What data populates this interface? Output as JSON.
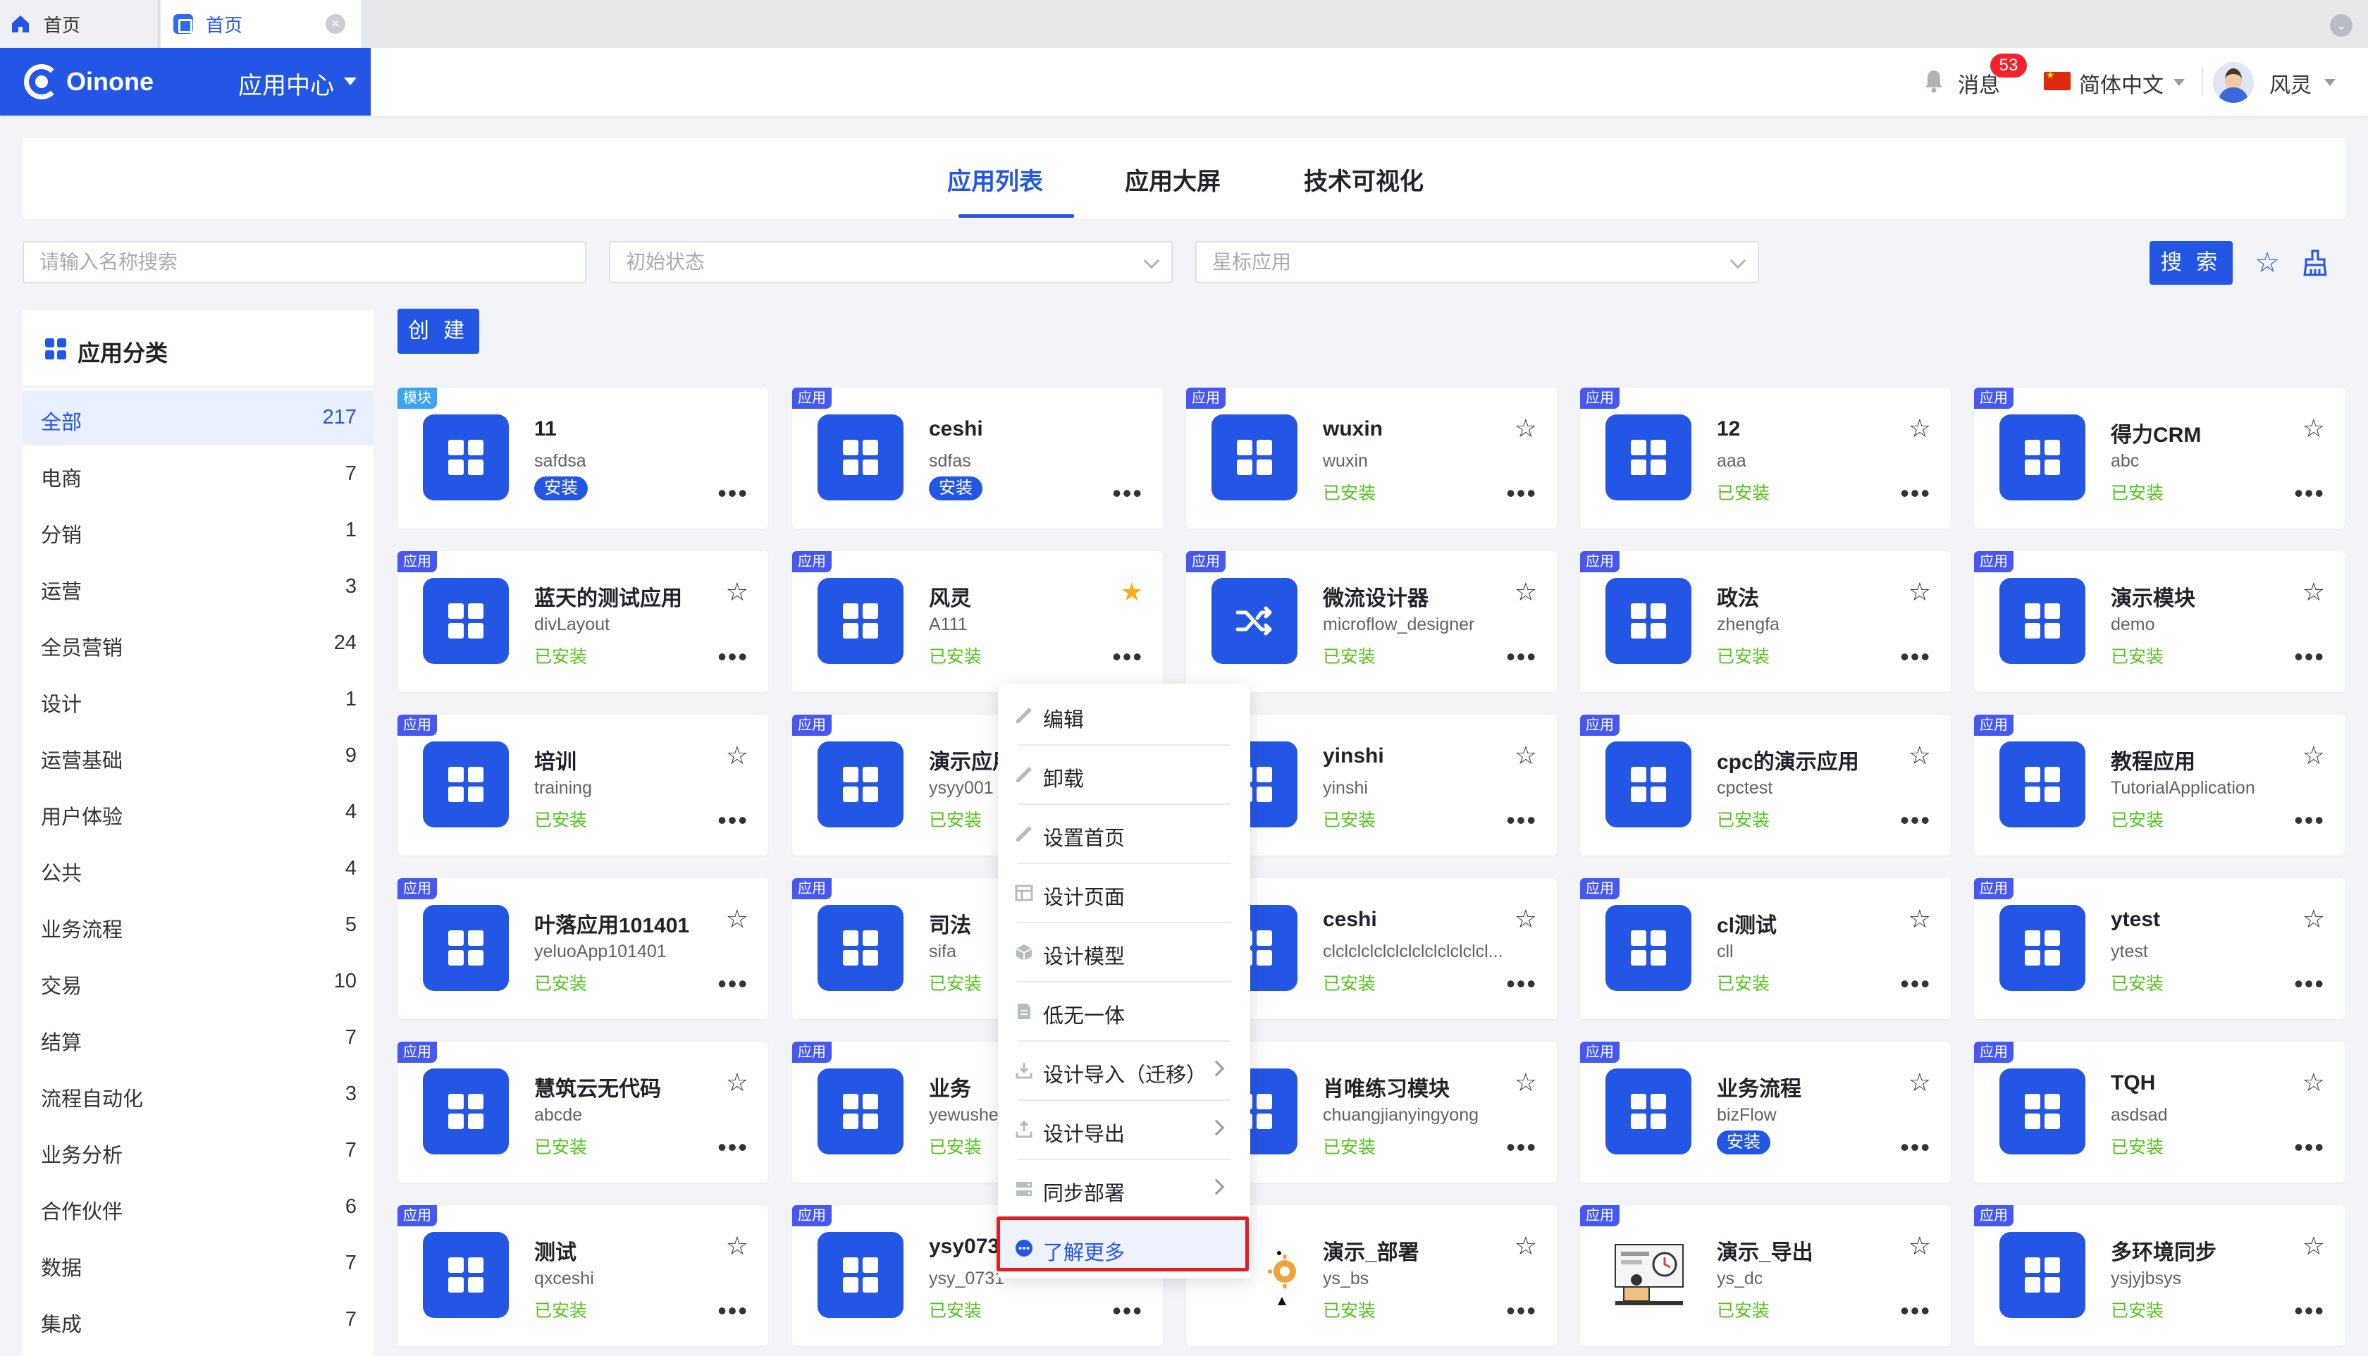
{
  "browser_tabs": [
    {
      "label": "首页",
      "icon": "home-icon"
    },
    {
      "label": "首页",
      "icon": "app-tab-icon"
    }
  ],
  "header": {
    "logo_text": "Oinone",
    "app_center": "应用中心",
    "messages_label": "消息",
    "messages_count": "53",
    "language": "简体中文",
    "user_name": "风灵"
  },
  "main_tabs": [
    "应用列表",
    "应用大屏",
    "技术可视化"
  ],
  "filters": {
    "search_placeholder": "请输入名称搜索",
    "status_placeholder": "初始状态",
    "star_placeholder": "星标应用",
    "search_button": "搜 索"
  },
  "sidebar": {
    "title": "应用分类",
    "items": [
      {
        "label": "全部",
        "count": "217"
      },
      {
        "label": "电商",
        "count": "7"
      },
      {
        "label": "分销",
        "count": "1"
      },
      {
        "label": "运营",
        "count": "3"
      },
      {
        "label": "全员营销",
        "count": "24"
      },
      {
        "label": "设计",
        "count": "1"
      },
      {
        "label": "运营基础",
        "count": "9"
      },
      {
        "label": "用户体验",
        "count": "4"
      },
      {
        "label": "公共",
        "count": "4"
      },
      {
        "label": "业务流程",
        "count": "5"
      },
      {
        "label": "交易",
        "count": "10"
      },
      {
        "label": "结算",
        "count": "7"
      },
      {
        "label": "流程自动化",
        "count": "3"
      },
      {
        "label": "业务分析",
        "count": "7"
      },
      {
        "label": "合作伙伴",
        "count": "6"
      },
      {
        "label": "数据",
        "count": "7"
      },
      {
        "label": "集成",
        "count": "7"
      }
    ]
  },
  "create_button": "创 建",
  "cards": [
    {
      "tag": "模块",
      "name": "11",
      "code": "safdsa",
      "status": "安装",
      "status_type": "install",
      "starred": false,
      "icon": "grid"
    },
    {
      "tag": "应用",
      "name": "ceshi",
      "code": "sdfas",
      "status": "安装",
      "status_type": "install",
      "starred": false,
      "icon": "grid"
    },
    {
      "tag": "应用",
      "name": "wuxin",
      "code": "wuxin",
      "status": "已安装",
      "status_type": "installed",
      "starred": false,
      "icon": "grid"
    },
    {
      "tag": "应用",
      "name": "12",
      "code": "aaa",
      "status": "已安装",
      "status_type": "installed",
      "starred": false,
      "icon": "grid"
    },
    {
      "tag": "应用",
      "name": "得力CRM",
      "code": "abc",
      "status": "已安装",
      "status_type": "installed",
      "starred": false,
      "icon": "grid"
    },
    {
      "tag": "应用",
      "name": "蓝天的测试应用",
      "code": "divLayout",
      "status": "已安装",
      "status_type": "installed",
      "starred": false,
      "icon": "grid"
    },
    {
      "tag": "应用",
      "name": "风灵",
      "code": "A111",
      "status": "已安装",
      "status_type": "installed",
      "starred": true,
      "icon": "grid"
    },
    {
      "tag": "应用",
      "name": "微流设计器",
      "code": "microflow_designer",
      "status": "已安装",
      "status_type": "installed",
      "starred": false,
      "icon": "shuffle"
    },
    {
      "tag": "应用",
      "name": "政法",
      "code": "zhengfa",
      "status": "已安装",
      "status_type": "installed",
      "starred": false,
      "icon": "grid"
    },
    {
      "tag": "应用",
      "name": "演示模块",
      "code": "demo",
      "status": "已安装",
      "status_type": "installed",
      "starred": false,
      "icon": "grid"
    },
    {
      "tag": "应用",
      "name": "培训",
      "code": "training",
      "status": "已安装",
      "status_type": "installed",
      "starred": false,
      "icon": "grid"
    },
    {
      "tag": "应用",
      "name": "演示应用",
      "code": "ysyy001",
      "status": "已安装",
      "status_type": "installed",
      "starred": false,
      "icon": "grid"
    },
    {
      "tag": "应用",
      "name": "yinshi",
      "code": "yinshi",
      "status": "已安装",
      "status_type": "installed",
      "starred": false,
      "icon": "grid"
    },
    {
      "tag": "应用",
      "name": "cpc的演示应用",
      "code": "cpctest",
      "status": "已安装",
      "status_type": "installed",
      "starred": false,
      "icon": "grid"
    },
    {
      "tag": "应用",
      "name": "教程应用",
      "code": "TutorialApplication",
      "status": "已安装",
      "status_type": "installed",
      "starred": false,
      "icon": "grid"
    },
    {
      "tag": "应用",
      "name": "叶落应用101401",
      "code": "yeluoApp101401",
      "status": "已安装",
      "status_type": "installed",
      "starred": false,
      "icon": "grid"
    },
    {
      "tag": "应用",
      "name": "司法",
      "code": "sifa",
      "status": "已安装",
      "status_type": "installed",
      "starred": false,
      "icon": "grid"
    },
    {
      "tag": "应用",
      "name": "ceshi",
      "code": "clclclclclclclclclclclclcl...",
      "status": "已安装",
      "status_type": "installed",
      "starred": false,
      "icon": "grid"
    },
    {
      "tag": "应用",
      "name": "cl测试",
      "code": "cll",
      "status": "已安装",
      "status_type": "installed",
      "starred": false,
      "icon": "grid"
    },
    {
      "tag": "应用",
      "name": "ytest",
      "code": "ytest",
      "status": "已安装",
      "status_type": "installed",
      "starred": false,
      "icon": "grid"
    },
    {
      "tag": "应用",
      "name": "慧筑云无代码",
      "code": "abcde",
      "status": "已安装",
      "status_type": "installed",
      "starred": false,
      "icon": "grid"
    },
    {
      "tag": "应用",
      "name": "业务",
      "code": "yewushen",
      "status": "已安装",
      "status_type": "installed",
      "starred": false,
      "icon": "grid"
    },
    {
      "tag": "应用",
      "name": "肖唯练习模块",
      "code": "chuangjianyingyong",
      "status": "已安装",
      "status_type": "installed",
      "starred": false,
      "icon": "grid"
    },
    {
      "tag": "应用",
      "name": "业务流程",
      "code": "bizFlow",
      "status": "安装",
      "status_type": "install",
      "starred": false,
      "icon": "grid"
    },
    {
      "tag": "应用",
      "name": "TQH",
      "code": "asdsad",
      "status": "已安装",
      "status_type": "installed",
      "starred": false,
      "icon": "grid"
    },
    {
      "tag": "应用",
      "name": "测试",
      "code": "qxceshi",
      "status": "已安装",
      "status_type": "installed",
      "starred": false,
      "icon": "grid"
    },
    {
      "tag": "应用",
      "name": "ysy073",
      "code": "ysy_0731",
      "status": "已安装",
      "status_type": "installed",
      "starred": false,
      "icon": "grid"
    },
    {
      "tag": "应用",
      "name": "演示_部署",
      "code": "ys_bs",
      "status": "已安装",
      "status_type": "installed",
      "starred": false,
      "icon": "gear-illus"
    },
    {
      "tag": "应用",
      "name": "演示_导出",
      "code": "ys_dc",
      "status": "已安装",
      "status_type": "installed",
      "starred": false,
      "icon": "export-illus"
    },
    {
      "tag": "应用",
      "name": "多环境同步",
      "code": "ysjyjbsys",
      "status": "已安装",
      "status_type": "installed",
      "starred": false,
      "icon": "grid"
    }
  ],
  "context_menu": {
    "items": [
      {
        "label": "编辑",
        "icon": "brush-icon",
        "submenu": false
      },
      {
        "label": "卸载",
        "icon": "brush-icon",
        "submenu": false
      },
      {
        "label": "设置首页",
        "icon": "brush-icon",
        "submenu": false
      },
      {
        "label": "设计页面",
        "icon": "layout-icon",
        "submenu": false
      },
      {
        "label": "设计模型",
        "icon": "cube-icon",
        "submenu": false
      },
      {
        "label": "低无一体",
        "icon": "doc-icon",
        "submenu": false
      },
      {
        "label": "设计导入（迁移）",
        "icon": "import-icon",
        "submenu": true
      },
      {
        "label": "设计导出",
        "icon": "export-icon",
        "submenu": true
      },
      {
        "label": "同步部署",
        "icon": "server-icon",
        "submenu": true
      },
      {
        "label": "了解更多",
        "icon": "more-circle-icon",
        "submenu": false
      }
    ]
  },
  "colors": {
    "primary": "#2456e6",
    "installed": "#52c41a",
    "star_on": "#faad14",
    "badge": "#f5222d",
    "highlight_border": "#e02020"
  }
}
